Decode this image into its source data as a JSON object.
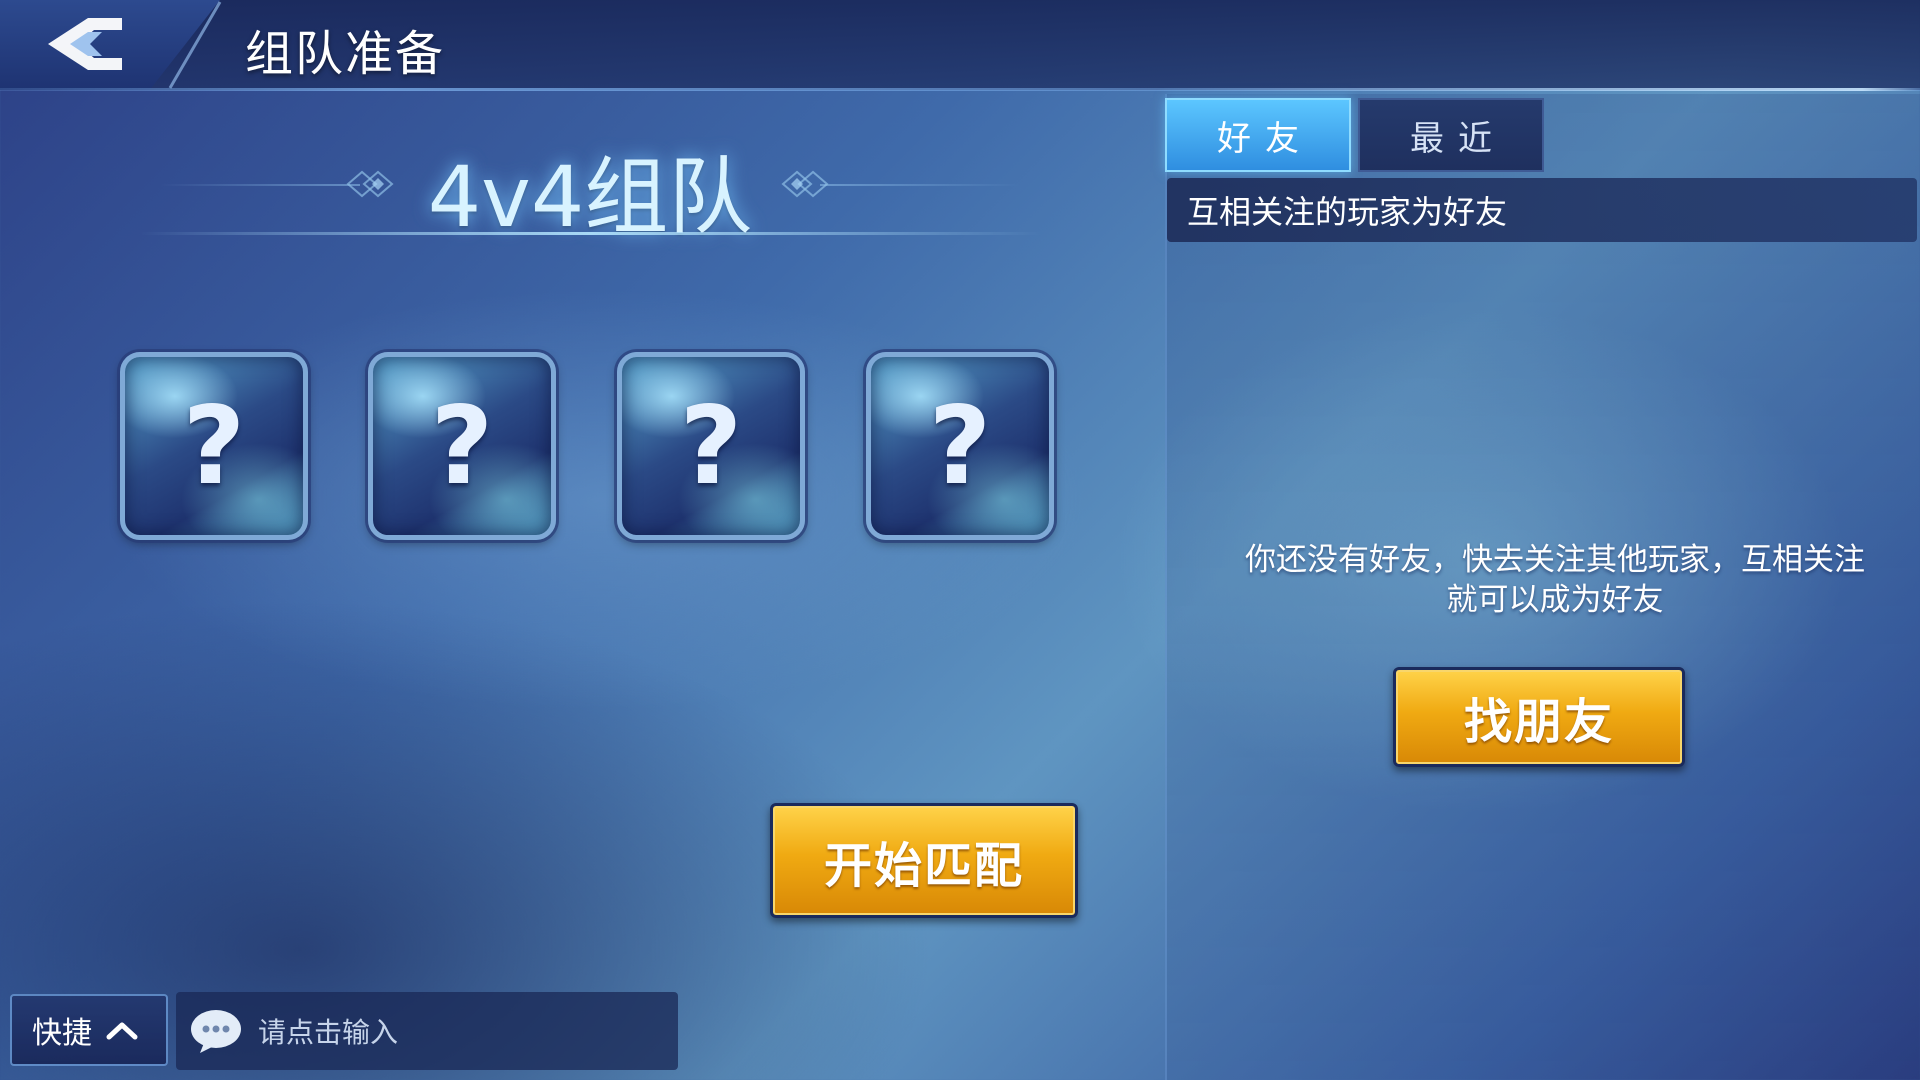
{
  "header": {
    "title": "组队准备",
    "back_icon": "back-arrow-icon"
  },
  "mode": {
    "title": "4v4组队"
  },
  "team_slots": [
    {
      "symbol": "?"
    },
    {
      "symbol": "?"
    },
    {
      "symbol": "?"
    },
    {
      "symbol": "?"
    }
  ],
  "actions": {
    "start_match_label": "开始匹配",
    "find_friends_label": "找朋友"
  },
  "bottom_bar": {
    "quick_label": "快捷",
    "chat_placeholder": "请点击输入",
    "chat_icon": "chat-bubble-icon"
  },
  "friends_panel": {
    "tabs": [
      {
        "label": "好友",
        "active": true
      },
      {
        "label": "最近",
        "active": false
      }
    ],
    "info": "互相关注的玩家为好友",
    "empty_message": "你还没有好友，快去关注其他玩家，互相关注就可以成为好友"
  },
  "colors": {
    "gold_button": "#f0aa12",
    "active_tab": "#2f8ee0",
    "title_glow": "#d8f3ff"
  }
}
